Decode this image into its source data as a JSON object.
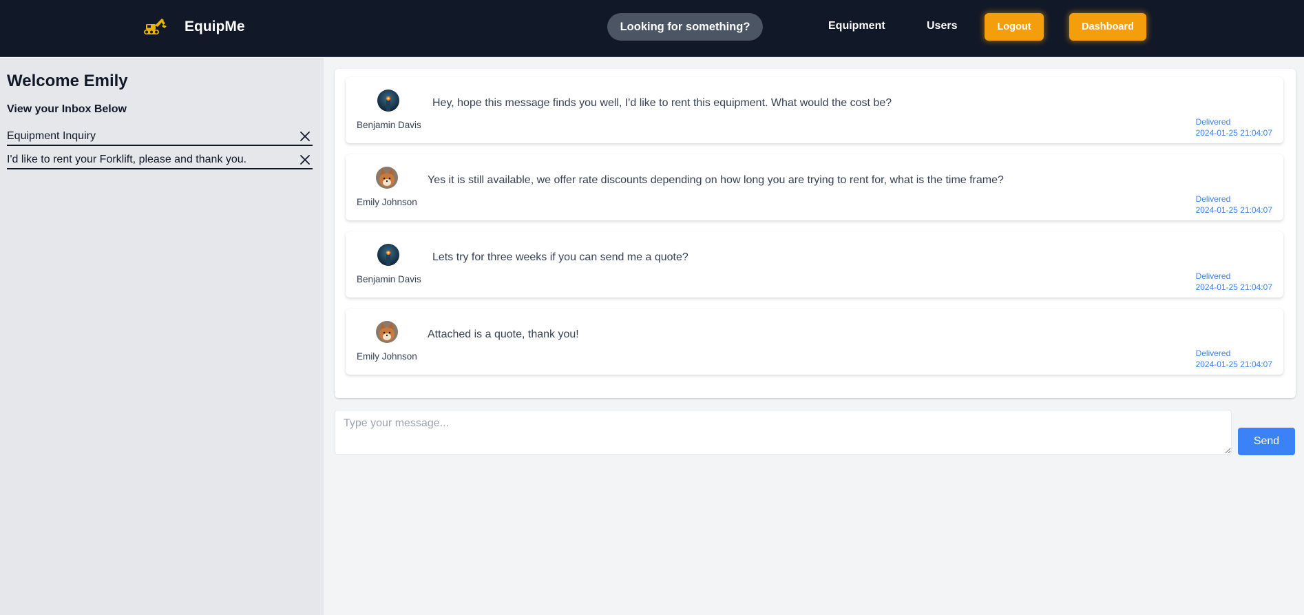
{
  "header": {
    "brand": "EquipMe",
    "logo_icon": "excavator-icon",
    "search_label": "Looking for something?",
    "nav": {
      "equipment": "Equipment",
      "users": "Users"
    },
    "logout": "Logout",
    "dashboard": "Dashboard"
  },
  "colors": {
    "header_bg": "#111827",
    "accent_orange": "#f59e0b",
    "accent_blue": "#3b82f6",
    "sidebar_bg": "#e5e7eb"
  },
  "sidebar": {
    "welcome": "Welcome Emily",
    "subtitle": "View your Inbox Below",
    "items": [
      {
        "label": "Equipment Inquiry",
        "icon": "close-icon"
      },
      {
        "label": "I'd like to rent your Forklift, please and thank you.",
        "icon": "close-icon"
      }
    ]
  },
  "messages": [
    {
      "sender": "Benjamin Davis",
      "avatar": "avatar-benjamin",
      "text": "Hey, hope this message finds you well, I'd like to rent this equipment. What would the cost be?",
      "status": "Delivered",
      "timestamp": "2024-01-25 21:04:07"
    },
    {
      "sender": "Emily Johnson",
      "avatar": "avatar-emily",
      "text": "Yes it is still available, we offer rate discounts depending on how long you are trying to rent for, what is the time frame?",
      "status": "Delivered",
      "timestamp": "2024-01-25 21:04:07"
    },
    {
      "sender": "Benjamin Davis",
      "avatar": "avatar-benjamin",
      "text": "Lets try for three weeks if you can send me a quote?",
      "status": "Delivered",
      "timestamp": "2024-01-25 21:04:07"
    },
    {
      "sender": "Emily Johnson",
      "avatar": "avatar-emily",
      "text": "Attached is a quote, thank you!",
      "status": "Delivered",
      "timestamp": "2024-01-25 21:04:07"
    }
  ],
  "composer": {
    "placeholder": "Type your message...",
    "value": "",
    "send_label": "Send"
  }
}
